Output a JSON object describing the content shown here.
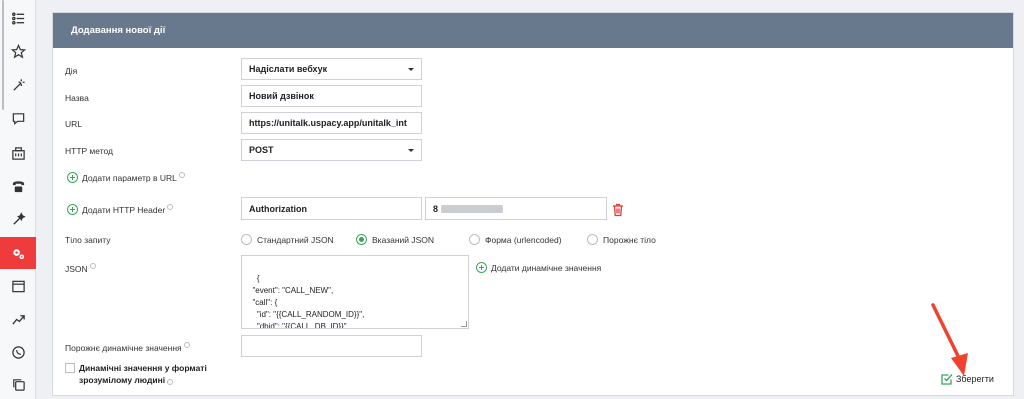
{
  "sidebar": {
    "icons": [
      "list-icon",
      "star-icon",
      "magic-wand-icon",
      "chat-icon",
      "building-icon",
      "phone-icon",
      "wand-icon",
      "gears-icon",
      "window-icon",
      "trend-icon",
      "whatsapp-icon",
      "copy-icon"
    ],
    "active_index": 7,
    "accent": "#ef3b3b"
  },
  "panel": {
    "title": "Додавання нової дії",
    "header_color": "#68788d"
  },
  "form": {
    "action_label": "Дія",
    "action_value": "Надіслати вебхук",
    "name_label": "Назва",
    "name_value": "Новий дзвінок",
    "url_label": "URL",
    "url_value": "https://unitalk.uspacy.app/unitalk_int",
    "method_label": "HTTP метод",
    "method_value": "POST",
    "add_url_param": "Додати параметр в URL",
    "add_header": "Додати HTTP Header",
    "header_name": "Authorization",
    "header_value": "8",
    "body_label": "Тіло запиту",
    "body_options": [
      "Стандартний JSON",
      "Вказаний JSON",
      "Форма (urlencoded)",
      "Порожнє тіло"
    ],
    "body_selected_index": 1,
    "json_label": "JSON",
    "json_value": "{\n  \"event\": \"CALL_NEW\",\n  \"call\": {\n    \"id\": \"{{CALL_RANDOM_ID}}\",\n    \"dbid\": \"{{CALL_DB_ID}}\",\n    \"from\": \"{{CALLED_FROM}}\",",
    "add_dynamic": "Додати динамічне значення",
    "empty_dynamic_label": "Порожнє динамічне значення",
    "empty_dynamic_value": "",
    "human_readable_label": "Динамічні значення у форматі зрозумілому людині",
    "human_readable_checked": false
  },
  "save": {
    "label": "Зберегти",
    "color": "#3ba55c"
  },
  "annotation": {
    "arrow_color": "#f0432f"
  }
}
